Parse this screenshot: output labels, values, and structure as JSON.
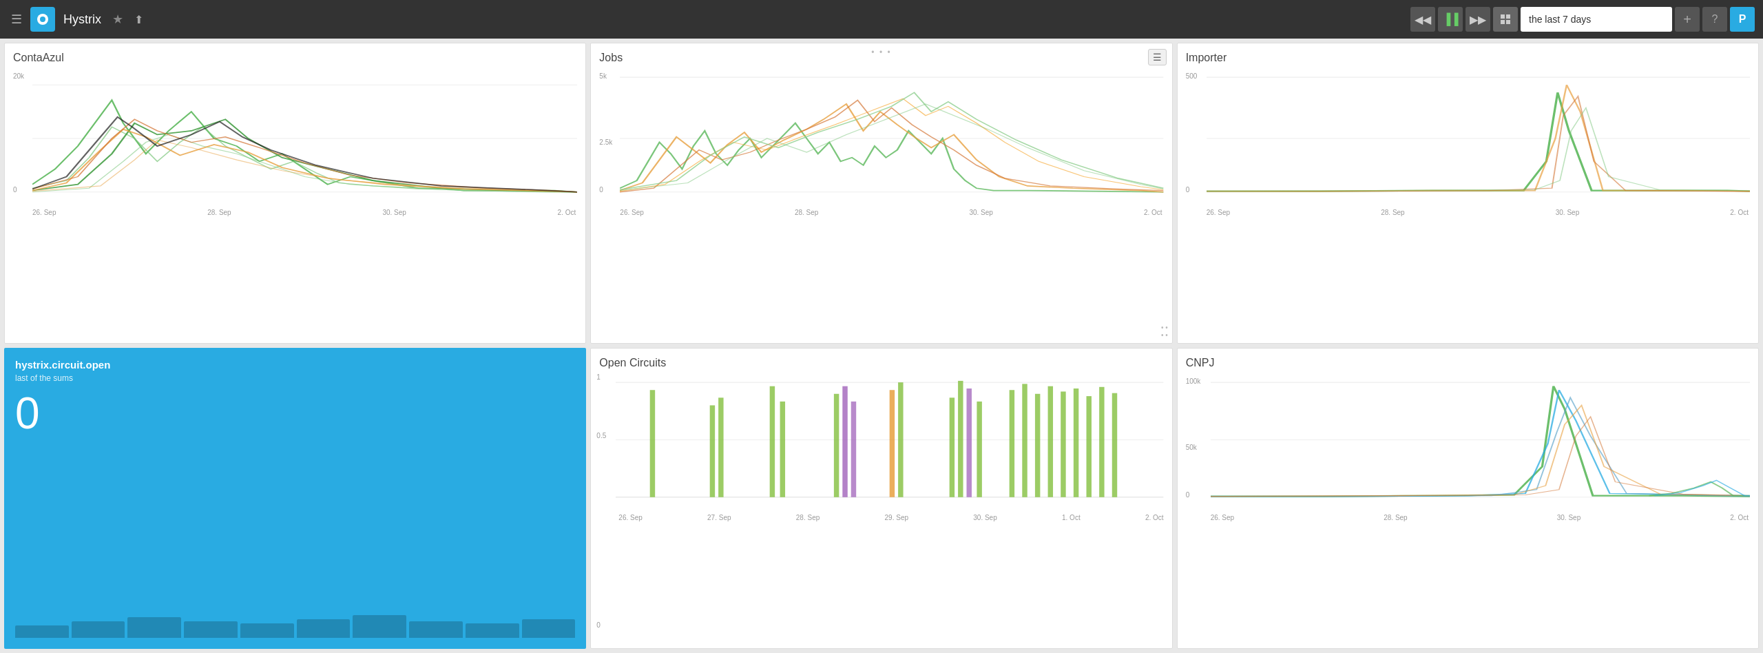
{
  "header": {
    "app_title": "Hystrix",
    "time_value": "the last 7 days",
    "menu_icon": "☰",
    "logo_text": "●",
    "star_icon": "★",
    "share_icon": "⬆",
    "rewind_icon": "◀◀",
    "pause_icon": "▐▐",
    "forward_icon": "▶▶",
    "grid_icon": "⊞",
    "plus_icon": "+",
    "question_icon": "?",
    "user_icon": "P"
  },
  "panels": {
    "contaazul": {
      "title": "ContaAzul",
      "y_labels": [
        "20k",
        "0"
      ],
      "x_labels": [
        "26. Sep",
        "28. Sep",
        "30. Sep",
        "2. Oct"
      ]
    },
    "jobs": {
      "title": "Jobs",
      "y_labels": [
        "5k",
        "2.5k",
        "0"
      ],
      "x_labels": [
        "26. Sep",
        "28. Sep",
        "30. Sep",
        "2. Oct"
      ]
    },
    "importer": {
      "title": "Importer",
      "y_labels": [
        "500",
        "0"
      ],
      "x_labels": [
        "26. Sep",
        "28. Sep",
        "30. Sep",
        "2. Oct"
      ]
    },
    "circuit_metric": {
      "title": "hystrix.circuit.open",
      "subtitle": "last of the sums",
      "value": "0",
      "bars": [
        3,
        4,
        5,
        4,
        3,
        4,
        5,
        4,
        3,
        4
      ]
    },
    "open_circuits": {
      "title": "Open Circuits",
      "y_labels": [
        "1",
        "0.5",
        "0"
      ],
      "x_labels": [
        "26. Sep",
        "27. Sep",
        "28. Sep",
        "29. Sep",
        "30. Sep",
        "1. Oct",
        "2. Oct"
      ]
    },
    "cnpj": {
      "title": "CNPJ",
      "y_labels": [
        "100k",
        "50k",
        "0"
      ],
      "x_labels": [
        "26. Sep",
        "28. Sep",
        "30. Sep",
        "2. Oct"
      ]
    }
  }
}
